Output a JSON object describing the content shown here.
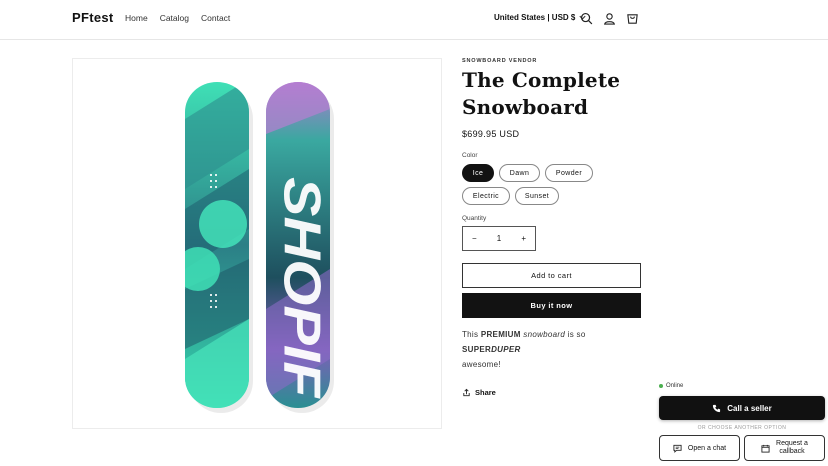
{
  "header": {
    "logo": "PFtest",
    "nav": [
      "Home",
      "Catalog",
      "Contact"
    ],
    "currency": "United States | USD $"
  },
  "product": {
    "vendor": "SNOWBOARD VENDOR",
    "title_line1": "The Complete",
    "title_line2": "Snowboard",
    "price": "$699.95 USD",
    "color_label": "Color",
    "colors": [
      "Ice",
      "Dawn",
      "Powder",
      "Electric",
      "Sunset"
    ],
    "selected_color": "Ice",
    "quantity_label": "Quantity",
    "quantity": "1",
    "minus": "−",
    "plus": "+",
    "add_to_cart": "Add to cart",
    "buy_now": "Buy it now",
    "desc_this": "This ",
    "desc_premium": "PREMIUM",
    "desc_snowboard": "snowboard",
    "desc_is_so": " is so ",
    "desc_super": "SUPER",
    "desc_duper": "DUPER",
    "desc_awesome": "awesome!",
    "share": "Share",
    "board_text": "SHOPIFY"
  },
  "widget": {
    "status": "Online",
    "call_label": "Call a seller",
    "or_label": "OR CHOOSE ANOTHER OPTION",
    "chat_label": "Open a chat",
    "callback_line1": "Request a",
    "callback_line2": "callback"
  },
  "colors": {
    "accent": "#121212",
    "board_teal": "#3fe0b6",
    "board_dark": "#2a5a6a",
    "board_purple": "#a06ac0",
    "online": "#4caf50"
  },
  "icons": [
    "search-icon",
    "account-icon",
    "cart-icon",
    "chevron-down-icon",
    "share-icon",
    "phone-icon",
    "chat-icon",
    "calendar-icon"
  ]
}
